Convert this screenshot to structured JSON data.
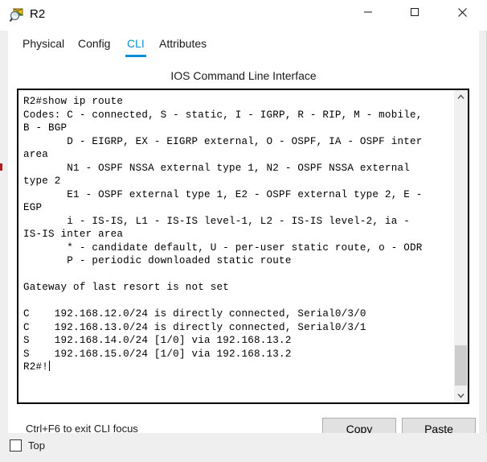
{
  "window": {
    "title": "R2",
    "icon": "inspect-magnifier-icon",
    "controls": {
      "minimize": "minimize-icon",
      "maximize": "maximize-icon",
      "close": "close-icon"
    }
  },
  "tabs": [
    {
      "label": "Physical",
      "active": false
    },
    {
      "label": "Config",
      "active": false
    },
    {
      "label": "CLI",
      "active": true
    },
    {
      "label": "Attributes",
      "active": false
    }
  ],
  "cli": {
    "header": "IOS Command Line Interface",
    "output": "R2#show ip route\nCodes: C - connected, S - static, I - IGRP, R - RIP, M - mobile,\nB - BGP\n       D - EIGRP, EX - EIGRP external, O - OSPF, IA - OSPF inter\narea\n       N1 - OSPF NSSA external type 1, N2 - OSPF NSSA external\ntype 2\n       E1 - OSPF external type 1, E2 - OSPF external type 2, E -\nEGP\n       i - IS-IS, L1 - IS-IS level-1, L2 - IS-IS level-2, ia -\nIS-IS inter area\n       * - candidate default, U - per-user static route, o - ODR\n       P - periodic downloaded static route\n\nGateway of last resort is not set\n\nC    192.168.12.0/24 is directly connected, Serial0/3/0\nC    192.168.13.0/24 is directly connected, Serial0/3/1\nS    192.168.14.0/24 [1/0] via 192.168.13.2\nS    192.168.15.0/24 [1/0] via 192.168.13.2\n",
    "prompt": "R2#!",
    "scrollbar": {
      "up_arrow": "chevron-up-icon",
      "down_arrow": "chevron-down-icon"
    }
  },
  "footer": {
    "hint": "Ctrl+F6 to exit CLI focus",
    "copy_label": "Copy",
    "paste_label": "Paste"
  },
  "bottom": {
    "top_label": "Top",
    "top_checked": false
  },
  "colors": {
    "accent": "#0a8fd8",
    "panel": "#ffffff",
    "chrome": "#efefef",
    "button_face": "#e1e1e1",
    "scroll_thumb": "#cdcdcd"
  }
}
